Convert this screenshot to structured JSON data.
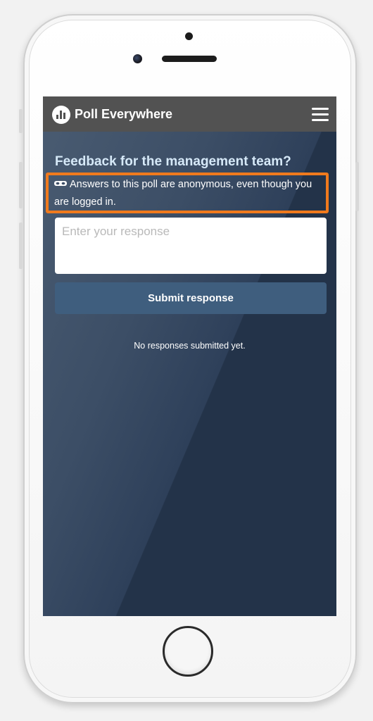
{
  "app": {
    "brand": "Poll Everywhere",
    "brand_icon": "poll-everywhere-logo-icon",
    "menu_icon": "hamburger-menu-icon"
  },
  "poll": {
    "title": "Feedback for the management team?",
    "anonymous_icon": "incognito-mask-icon",
    "anonymous_notice": "Answers to this poll are anonymous, even though you are logged in.",
    "input_placeholder": "Enter your response",
    "input_value": "",
    "submit_label": "Submit response",
    "status_text": "No responses submitted yet."
  },
  "colors": {
    "navbar": "#525252",
    "background": "#233349",
    "title": "#d6e9f8",
    "highlight_border": "#f07a1d",
    "submit_button": "#3f5e7e"
  }
}
